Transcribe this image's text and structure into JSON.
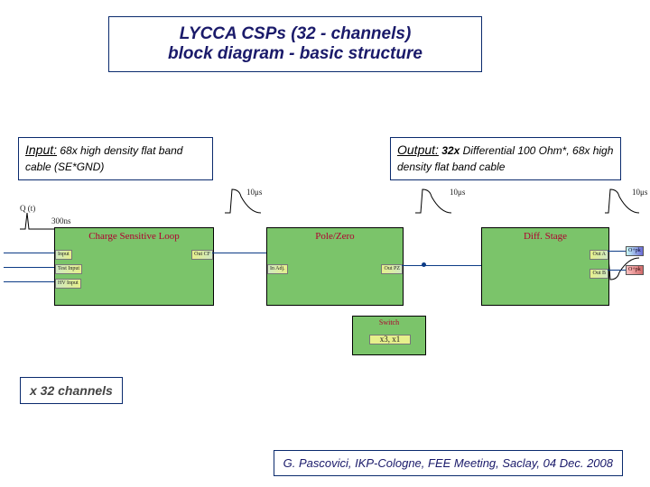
{
  "header": {
    "line1": "LYCCA   CSPs  (32 - channels)",
    "line2": "block diagram - basic   structure"
  },
  "input_box": {
    "label": "Input:",
    "detail": "  68x high density flat band cable (SE*GND)"
  },
  "output_box": {
    "label": "Output:",
    "bold": "  32x ",
    "detail": "Differential 100 Ohm*, 68x high density flat band cable"
  },
  "annotations": {
    "q_label": "Q (t)",
    "time_300ns": "300ns",
    "time_10us_1": "10μs",
    "time_10us_2": "10μs",
    "time_10us_3": "10μs"
  },
  "blocks": {
    "csl": {
      "title": "Charge Sensitive Loop",
      "ports_left": [
        "Input",
        "Test Input",
        "HV Input"
      ],
      "ports_right": [
        "Out CF"
      ]
    },
    "pz": {
      "title": "Pole/Zero",
      "ports_left": [
        "In Adj."
      ],
      "ports_right": [
        "Out PZ"
      ]
    },
    "diff": {
      "title": "Diff. Stage",
      "ports_right": [
        "Out A",
        "Out B"
      ],
      "output_tags": [
        "O+pk",
        "O+pk"
      ]
    },
    "switch": {
      "title": "Switch",
      "label": "x3, x1"
    }
  },
  "x32": "x 32 channels",
  "footer": "G. Pascovici,  IKP-Cologne,  FEE Meeting,  Saclay,  04 Dec. 2008"
}
